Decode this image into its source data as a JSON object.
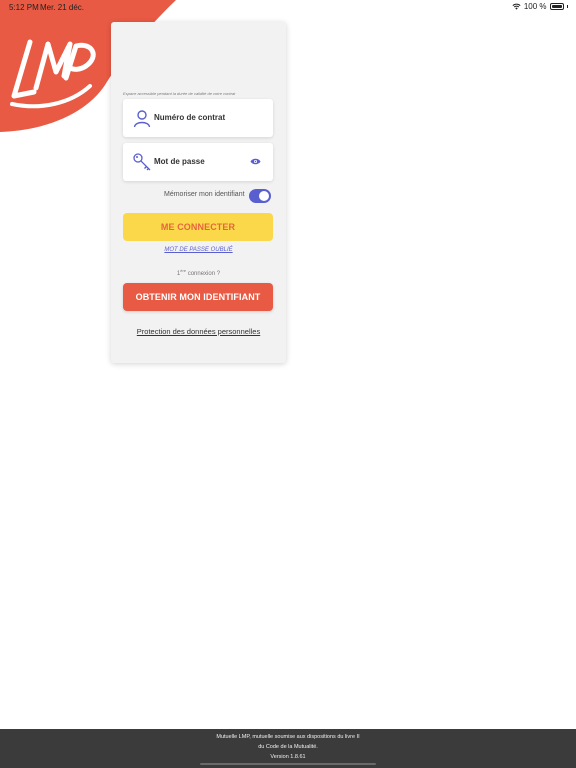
{
  "status_bar": {
    "time": "5:12 PM",
    "date": "Mer. 21 déc.",
    "battery": "100 %"
  },
  "brand": {
    "logo_text": "LMP",
    "accent_color": "#e85a43",
    "primary_color": "#5a5fd0",
    "yellow_color": "#fbd84a"
  },
  "login": {
    "hint": "Espace accessible pendant la durée de validité de votre contrat",
    "contract_label": "Numéro de contrat",
    "password_label": "Mot de passe",
    "remember_label": "Mémoriser mon identifiant",
    "remember_on": true,
    "connect_label": "ME CONNECTER",
    "forgot_label": "MOT DE PASSE OUBLIÉ",
    "first_prefix": "1",
    "first_sup": "ère",
    "first_suffix": " connexion ?",
    "obtain_label": "OBTENIR MON IDENTIFIANT",
    "privacy_label": "Protection des données personnelles"
  },
  "icons": {
    "user": "user-icon",
    "key": "key-icon",
    "eye": "eye-icon",
    "wifi": "wifi-icon",
    "battery": "battery-icon"
  },
  "footer": {
    "line1": "Mutuelle LMP, mutuelle soumise aux dispositions du livre II",
    "line2": "du Code de la Mutualité.",
    "version": "Version 1.8.61"
  }
}
